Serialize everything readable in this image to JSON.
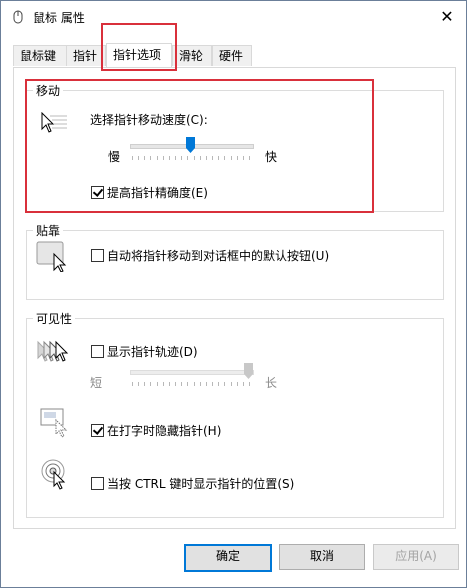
{
  "window": {
    "title": "鼠标 属性",
    "close_glyph": "✕"
  },
  "tabs": [
    {
      "label": "鼠标键"
    },
    {
      "label": "指针"
    },
    {
      "label": "指针选项"
    },
    {
      "label": "滑轮"
    },
    {
      "label": "硬件"
    }
  ],
  "active_tab": "指针选项",
  "motion": {
    "legend": "移动",
    "speed_label": "选择指针移动速度(C):",
    "slow_label": "慢",
    "fast_label": "快",
    "speed_level": 0.5,
    "precision_label": "提高指针精确度(E)",
    "precision_checked": true
  },
  "snap": {
    "legend": "贴靠",
    "snap_label": "自动将指针移动到对话框中的默认按钮(U)",
    "snap_checked": false
  },
  "visibility": {
    "legend": "可见性",
    "trails_label": "显示指针轨迹(D)",
    "trails_checked": false,
    "short_label": "短",
    "long_label": "长",
    "trail_level": 1.0,
    "hide_label": "在打字时隐藏指针(H)",
    "hide_checked": true,
    "ctrl_label": "当按 CTRL 键时显示指针的位置(S)",
    "ctrl_checked": false
  },
  "buttons": {
    "ok": "确定",
    "cancel": "取消",
    "apply": "应用(A)"
  },
  "colors": {
    "highlight": "#d9303b",
    "accent": "#0078d7",
    "slider_thumb": "#0078d7"
  },
  "icons": [
    "mouse-app-icon",
    "pointer-speed-icon",
    "snap-to-icon",
    "pointer-trails-icon",
    "hide-pointer-icon",
    "locate-pointer-icon",
    "close-icon"
  ]
}
